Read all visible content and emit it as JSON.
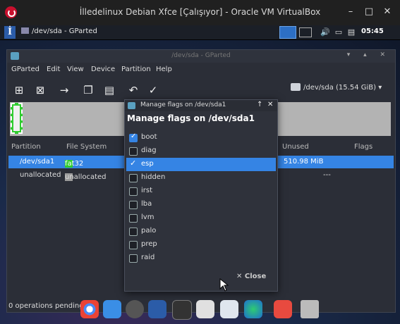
{
  "host": {
    "title": "İlledelinux Debian Xfce [Çalışıyor] - Oracle VM VirtualBox",
    "buttons": [
      "–",
      "□",
      "✕"
    ]
  },
  "panel": {
    "logo": "İ",
    "task_label": "/dev/sda - GParted",
    "clock": "05:45",
    "icons": [
      "volume-icon",
      "keyboard-icon",
      "network-icon"
    ]
  },
  "gparted": {
    "window_title": "/dev/sda - GParted",
    "menu": [
      "GParted",
      "Edit",
      "View",
      "Device",
      "Partition",
      "Help"
    ],
    "device_selector": "/dev/sda  (15.54 GiB)",
    "columns": {
      "partition": "Partition",
      "filesystem": "File System",
      "unused": "Unused",
      "flags": "Flags"
    },
    "rows": [
      {
        "partition": "/dev/sda1",
        "filesystem": "fat32",
        "fs_color": "#2ecc2e",
        "unused": "510.98 MiB",
        "selected": true
      },
      {
        "partition": "unallocated",
        "filesystem": "unallocated",
        "fs_color": "#9a9a9a",
        "unused": "---",
        "selected": false
      }
    ],
    "status": "0 operations pending"
  },
  "dialog": {
    "window_title": "Manage flags on /dev/sda1",
    "heading": "Manage flags on /dev/sda1",
    "title_buttons": [
      "↑",
      "✕"
    ],
    "flags": [
      {
        "name": "boot",
        "checked": true,
        "selected": false
      },
      {
        "name": "diag",
        "checked": false,
        "selected": false
      },
      {
        "name": "esp",
        "checked": true,
        "selected": true
      },
      {
        "name": "hidden",
        "checked": false,
        "selected": false
      },
      {
        "name": "irst",
        "checked": false,
        "selected": false
      },
      {
        "name": "lba",
        "checked": false,
        "selected": false
      },
      {
        "name": "lvm",
        "checked": false,
        "selected": false
      },
      {
        "name": "palo",
        "checked": false,
        "selected": false
      },
      {
        "name": "prep",
        "checked": false,
        "selected": false
      },
      {
        "name": "raid",
        "checked": false,
        "selected": false
      }
    ],
    "close_label": "Close"
  },
  "colors": {
    "accent": "#3584e4",
    "fat32": "#2ecc2e"
  }
}
